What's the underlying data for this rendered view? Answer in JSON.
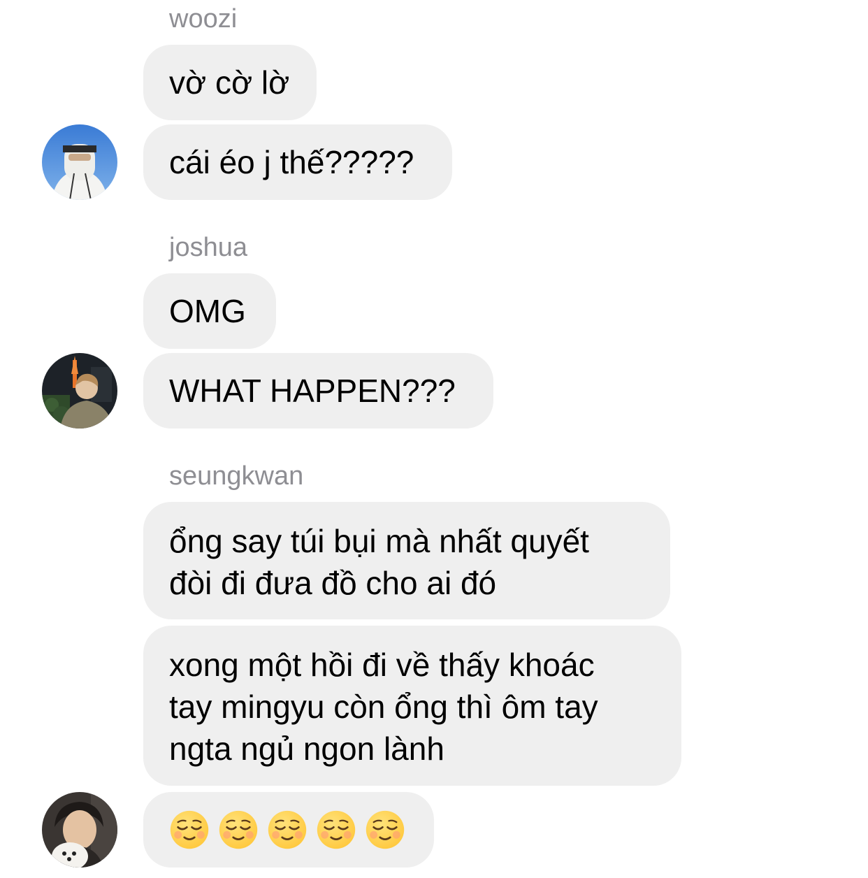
{
  "groups": [
    {
      "sender": "woozi",
      "avatar": "woozi-avatar",
      "messages": [
        "vờ cờ lờ",
        "cái éo j thế?????"
      ]
    },
    {
      "sender": "joshua",
      "avatar": "joshua-avatar",
      "messages": [
        "OMG",
        "WHAT HAPPEN???"
      ]
    },
    {
      "sender": "seungkwan",
      "avatar": "seungkwan-avatar",
      "messages": [
        "ổng say túi bụi mà nhất quyết\nđòi đi đưa đồ cho ai đó",
        "xong một hồi đi về thấy khoác\ntay mingyu còn ổng thì ôm tay\nngta ngủ ngon lành",
        "☺☺☺☺☺"
      ]
    }
  ],
  "emoji": {
    "name": "smiling-face-emoji",
    "count": 5
  },
  "colors": {
    "bubble": "#efefef",
    "sender": "#8e8e93",
    "emoji_face": "#ffc83d"
  }
}
